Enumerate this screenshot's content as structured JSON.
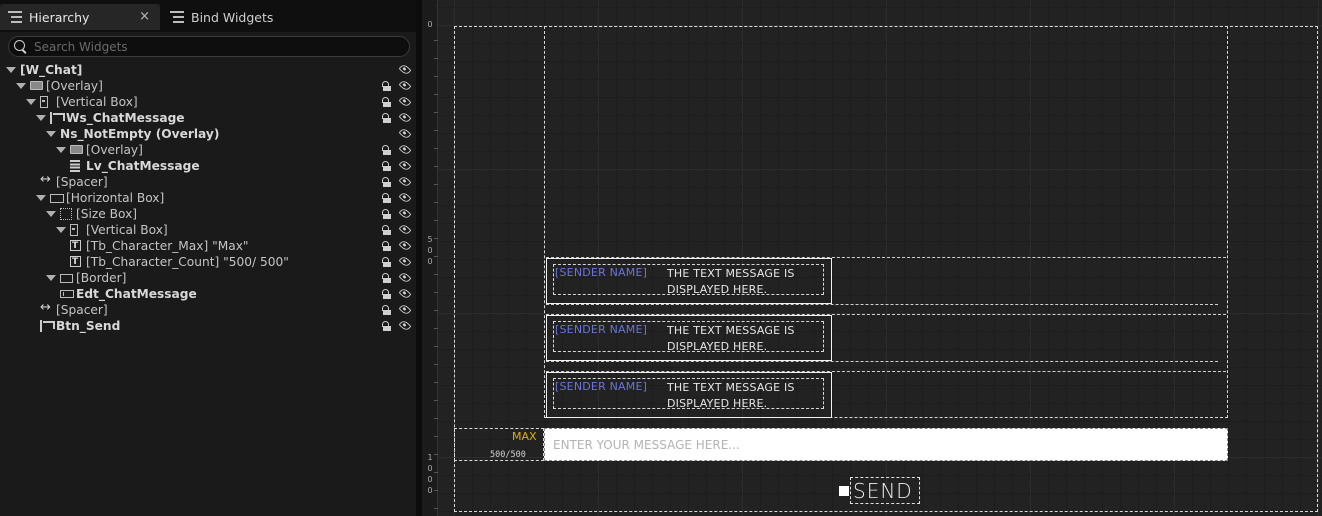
{
  "tabs": {
    "hierarchy": "Hierarchy",
    "bind_widgets": "Bind Widgets",
    "close": "×"
  },
  "search": {
    "placeholder": "Search Widgets"
  },
  "tree": [
    {
      "label": "[W_Chat]",
      "bold": true,
      "depth": 0,
      "arrow": true,
      "icon": "none",
      "lock": false
    },
    {
      "label": "[Overlay]",
      "bold": false,
      "depth": 1,
      "arrow": true,
      "icon": "overlay-icon",
      "lock": true
    },
    {
      "label": "[Vertical Box]",
      "bold": false,
      "depth": 2,
      "arrow": true,
      "icon": "vertical-box-icon",
      "lock": true
    },
    {
      "label": "Ws_ChatMessage",
      "bold": true,
      "depth": 3,
      "arrow": true,
      "icon": "widget-switcher-icon",
      "lock": true
    },
    {
      "label": "Ns_NotEmpty (Overlay)",
      "bold": true,
      "depth": 4,
      "arrow": true,
      "icon": "none",
      "lock": false
    },
    {
      "label": "[Overlay]",
      "bold": false,
      "depth": 5,
      "arrow": true,
      "icon": "overlay-icon",
      "lock": true
    },
    {
      "label": "Lv_ChatMessage",
      "bold": true,
      "depth": 6,
      "arrow": false,
      "icon": "list-view-icon",
      "lock": true
    },
    {
      "label": "[Spacer]",
      "bold": false,
      "depth": 3,
      "arrow": false,
      "icon": "spacer-icon",
      "lock": true
    },
    {
      "label": "[Horizontal Box]",
      "bold": false,
      "depth": 3,
      "arrow": true,
      "icon": "horizontal-box-icon",
      "lock": true
    },
    {
      "label": "[Size Box]",
      "bold": false,
      "depth": 4,
      "arrow": true,
      "icon": "size-box-icon",
      "lock": true
    },
    {
      "label": "[Vertical Box]",
      "bold": false,
      "depth": 5,
      "arrow": true,
      "icon": "vertical-box-icon",
      "lock": true
    },
    {
      "label": "[Tb_Character_Max] \"Max\"",
      "bold": false,
      "depth": 6,
      "arrow": false,
      "icon": "text-block-icon",
      "lock": true
    },
    {
      "label": "[Tb_Character_Count] \"500/ 500\"",
      "bold": false,
      "depth": 6,
      "arrow": false,
      "icon": "text-block-icon",
      "lock": true
    },
    {
      "label": "[Border]",
      "bold": false,
      "depth": 4,
      "arrow": true,
      "icon": "border-icon",
      "lock": true
    },
    {
      "label": "Edt_ChatMessage",
      "bold": true,
      "depth": 5,
      "arrow": false,
      "icon": "editable-text-icon",
      "lock": true
    },
    {
      "label": "[Spacer]",
      "bold": false,
      "depth": 3,
      "arrow": false,
      "icon": "spacer-icon",
      "lock": true
    },
    {
      "label": "Btn_Send",
      "bold": true,
      "depth": 3,
      "arrow": false,
      "icon": "button-icon",
      "lock": true
    }
  ],
  "ruler": [
    {
      "text": "0"
    },
    {
      "text": "5"
    },
    {
      "text": "0"
    },
    {
      "text": "0"
    },
    {
      "text": "1"
    },
    {
      "text": "0"
    },
    {
      "text": "0"
    },
    {
      "text": "0"
    }
  ],
  "messages": [
    {
      "sender": "[SENDER NAME]",
      "line1": "THE TEXT MESSAGE IS",
      "line2": "DISPLAYED HERE."
    },
    {
      "sender": "[SENDER NAME]",
      "line1": "THE TEXT MESSAGE IS",
      "line2": "DISPLAYED HERE."
    },
    {
      "sender": "[SENDER NAME]",
      "line1": "THE TEXT MESSAGE IS",
      "line2": "DISPLAYED HERE."
    }
  ],
  "input": {
    "max_label": "MAX",
    "count": "500/500",
    "placeholder": "ENTER YOUR MESSAGE HERE...",
    "value": ""
  },
  "send_button": {
    "label": "SEND"
  },
  "colors": {
    "sender": "#6a74dc",
    "max_label": "#d9b300",
    "panel_bg": "#1a1a1a",
    "canvas_bg": "#222222"
  }
}
